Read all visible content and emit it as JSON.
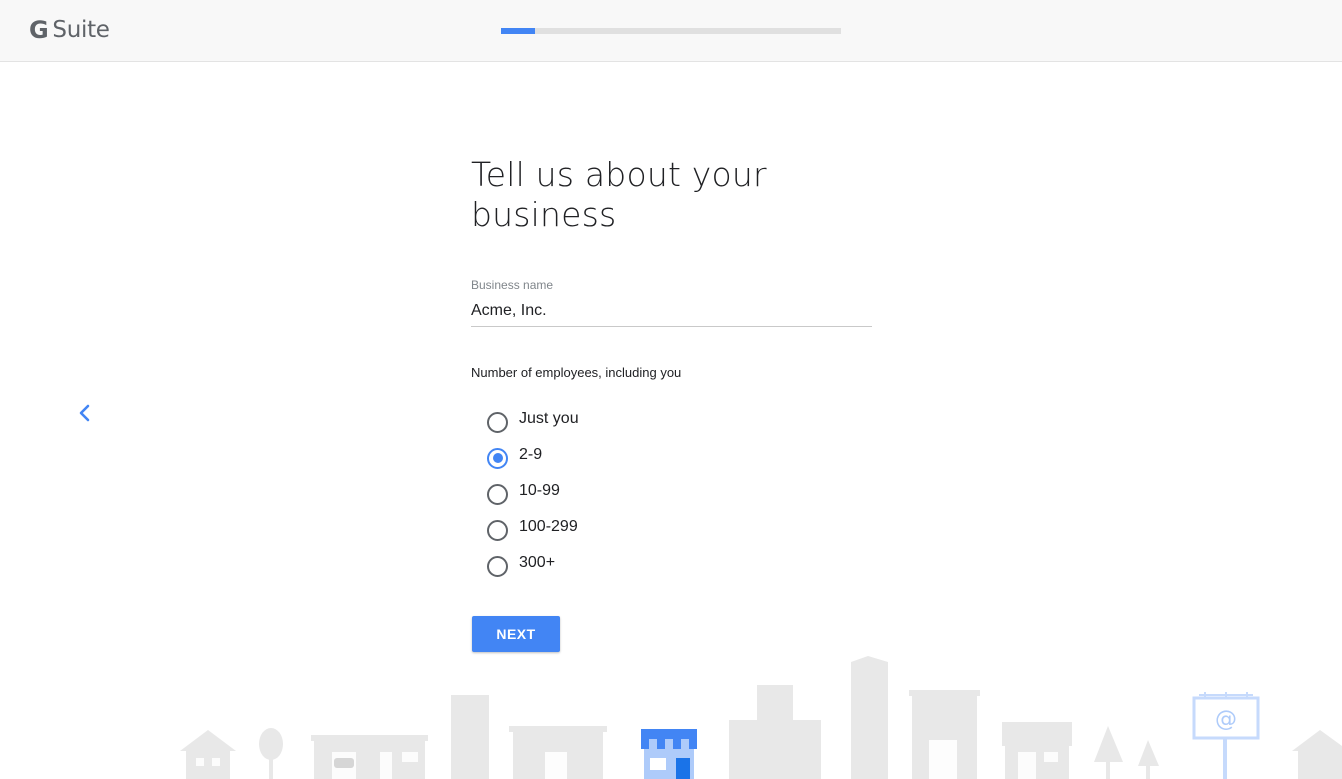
{
  "app": {
    "logo_text": "Suite",
    "logo_letter": "G"
  },
  "progress": {
    "fraction": 0.1
  },
  "page": {
    "title": "Tell us about your business"
  },
  "business_name": {
    "label": "Business name",
    "value": "Acme, Inc."
  },
  "employees": {
    "question": "Number of employees, including you",
    "options": [
      {
        "label": "Just you",
        "selected": false
      },
      {
        "label": "2-9",
        "selected": true
      },
      {
        "label": "10-99",
        "selected": false
      },
      {
        "label": "100-299",
        "selected": false
      },
      {
        "label": "300+",
        "selected": false
      }
    ]
  },
  "actions": {
    "next_label": "NEXT"
  },
  "billboard": {
    "symbol": "@"
  },
  "colors": {
    "accent": "#4285f4",
    "illustration": "#e8e8e8",
    "store_blue": "#4285f4"
  },
  "icons": {
    "back": "chevron-left-icon"
  }
}
